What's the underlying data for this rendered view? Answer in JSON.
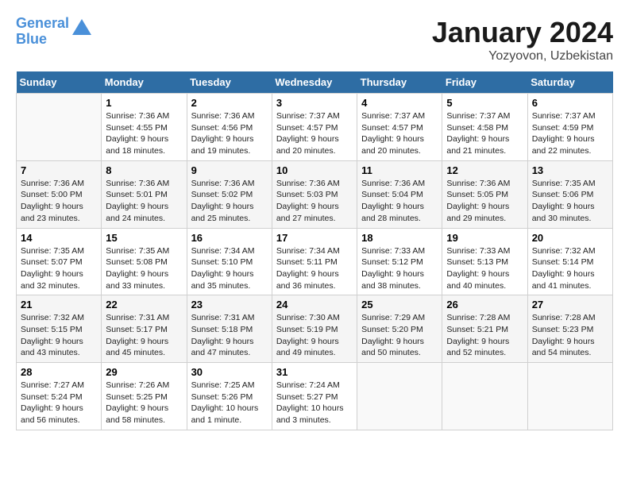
{
  "header": {
    "logo_line1": "General",
    "logo_line2": "Blue",
    "month": "January 2024",
    "location": "Yozyovon, Uzbekistan"
  },
  "weekdays": [
    "Sunday",
    "Monday",
    "Tuesday",
    "Wednesday",
    "Thursday",
    "Friday",
    "Saturday"
  ],
  "weeks": [
    [
      {
        "day": "",
        "info": ""
      },
      {
        "day": "1",
        "info": "Sunrise: 7:36 AM\nSunset: 4:55 PM\nDaylight: 9 hours\nand 18 minutes."
      },
      {
        "day": "2",
        "info": "Sunrise: 7:36 AM\nSunset: 4:56 PM\nDaylight: 9 hours\nand 19 minutes."
      },
      {
        "day": "3",
        "info": "Sunrise: 7:37 AM\nSunset: 4:57 PM\nDaylight: 9 hours\nand 20 minutes."
      },
      {
        "day": "4",
        "info": "Sunrise: 7:37 AM\nSunset: 4:57 PM\nDaylight: 9 hours\nand 20 minutes."
      },
      {
        "day": "5",
        "info": "Sunrise: 7:37 AM\nSunset: 4:58 PM\nDaylight: 9 hours\nand 21 minutes."
      },
      {
        "day": "6",
        "info": "Sunrise: 7:37 AM\nSunset: 4:59 PM\nDaylight: 9 hours\nand 22 minutes."
      }
    ],
    [
      {
        "day": "7",
        "info": "Sunrise: 7:36 AM\nSunset: 5:00 PM\nDaylight: 9 hours\nand 23 minutes."
      },
      {
        "day": "8",
        "info": "Sunrise: 7:36 AM\nSunset: 5:01 PM\nDaylight: 9 hours\nand 24 minutes."
      },
      {
        "day": "9",
        "info": "Sunrise: 7:36 AM\nSunset: 5:02 PM\nDaylight: 9 hours\nand 25 minutes."
      },
      {
        "day": "10",
        "info": "Sunrise: 7:36 AM\nSunset: 5:03 PM\nDaylight: 9 hours\nand 27 minutes."
      },
      {
        "day": "11",
        "info": "Sunrise: 7:36 AM\nSunset: 5:04 PM\nDaylight: 9 hours\nand 28 minutes."
      },
      {
        "day": "12",
        "info": "Sunrise: 7:36 AM\nSunset: 5:05 PM\nDaylight: 9 hours\nand 29 minutes."
      },
      {
        "day": "13",
        "info": "Sunrise: 7:35 AM\nSunset: 5:06 PM\nDaylight: 9 hours\nand 30 minutes."
      }
    ],
    [
      {
        "day": "14",
        "info": "Sunrise: 7:35 AM\nSunset: 5:07 PM\nDaylight: 9 hours\nand 32 minutes."
      },
      {
        "day": "15",
        "info": "Sunrise: 7:35 AM\nSunset: 5:08 PM\nDaylight: 9 hours\nand 33 minutes."
      },
      {
        "day": "16",
        "info": "Sunrise: 7:34 AM\nSunset: 5:10 PM\nDaylight: 9 hours\nand 35 minutes."
      },
      {
        "day": "17",
        "info": "Sunrise: 7:34 AM\nSunset: 5:11 PM\nDaylight: 9 hours\nand 36 minutes."
      },
      {
        "day": "18",
        "info": "Sunrise: 7:33 AM\nSunset: 5:12 PM\nDaylight: 9 hours\nand 38 minutes."
      },
      {
        "day": "19",
        "info": "Sunrise: 7:33 AM\nSunset: 5:13 PM\nDaylight: 9 hours\nand 40 minutes."
      },
      {
        "day": "20",
        "info": "Sunrise: 7:32 AM\nSunset: 5:14 PM\nDaylight: 9 hours\nand 41 minutes."
      }
    ],
    [
      {
        "day": "21",
        "info": "Sunrise: 7:32 AM\nSunset: 5:15 PM\nDaylight: 9 hours\nand 43 minutes."
      },
      {
        "day": "22",
        "info": "Sunrise: 7:31 AM\nSunset: 5:17 PM\nDaylight: 9 hours\nand 45 minutes."
      },
      {
        "day": "23",
        "info": "Sunrise: 7:31 AM\nSunset: 5:18 PM\nDaylight: 9 hours\nand 47 minutes."
      },
      {
        "day": "24",
        "info": "Sunrise: 7:30 AM\nSunset: 5:19 PM\nDaylight: 9 hours\nand 49 minutes."
      },
      {
        "day": "25",
        "info": "Sunrise: 7:29 AM\nSunset: 5:20 PM\nDaylight: 9 hours\nand 50 minutes."
      },
      {
        "day": "26",
        "info": "Sunrise: 7:28 AM\nSunset: 5:21 PM\nDaylight: 9 hours\nand 52 minutes."
      },
      {
        "day": "27",
        "info": "Sunrise: 7:28 AM\nSunset: 5:23 PM\nDaylight: 9 hours\nand 54 minutes."
      }
    ],
    [
      {
        "day": "28",
        "info": "Sunrise: 7:27 AM\nSunset: 5:24 PM\nDaylight: 9 hours\nand 56 minutes."
      },
      {
        "day": "29",
        "info": "Sunrise: 7:26 AM\nSunset: 5:25 PM\nDaylight: 9 hours\nand 58 minutes."
      },
      {
        "day": "30",
        "info": "Sunrise: 7:25 AM\nSunset: 5:26 PM\nDaylight: 10 hours\nand 1 minute."
      },
      {
        "day": "31",
        "info": "Sunrise: 7:24 AM\nSunset: 5:27 PM\nDaylight: 10 hours\nand 3 minutes."
      },
      {
        "day": "",
        "info": ""
      },
      {
        "day": "",
        "info": ""
      },
      {
        "day": "",
        "info": ""
      }
    ]
  ]
}
